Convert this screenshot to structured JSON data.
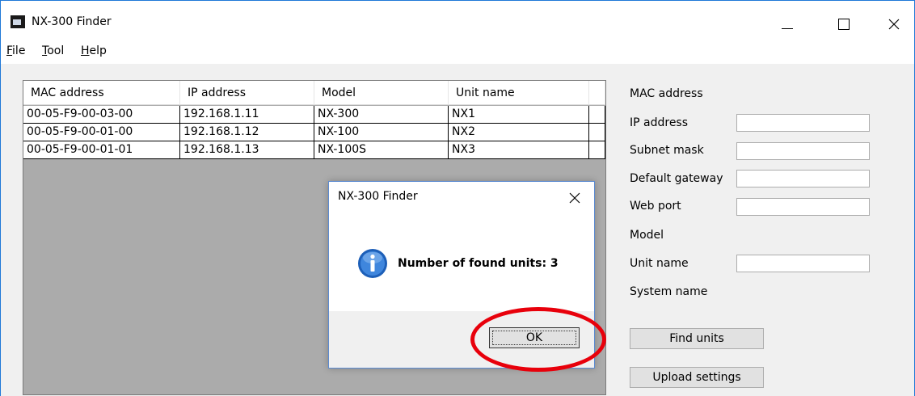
{
  "window": {
    "title": "NX-300 Finder",
    "icon": "app-speaker-icon"
  },
  "menu": {
    "items": [
      "File",
      "Tool",
      "Help"
    ]
  },
  "table": {
    "columns": [
      "MAC address",
      "IP address",
      "Model",
      "Unit name"
    ],
    "rows": [
      [
        "00-05-F9-00-03-00",
        "192.168.1.11",
        "NX-300",
        "NX1"
      ],
      [
        "00-05-F9-00-01-00",
        "192.168.1.12",
        "NX-100",
        "NX2"
      ],
      [
        "00-05-F9-00-01-01",
        "192.168.1.13",
        "NX-100S",
        "NX3"
      ]
    ]
  },
  "settings": {
    "mac_label": "MAC address",
    "ip_label": "IP address",
    "subnet_label": "Subnet mask",
    "gateway_label": "Default gateway",
    "webport_label": "Web port",
    "model_label": "Model",
    "unitname_label": "Unit name",
    "systemname_label": "System name",
    "ip_value": "",
    "subnet_value": "",
    "gateway_value": "",
    "webport_value": "",
    "unitname_value": ""
  },
  "buttons": {
    "find_units": "Find units",
    "upload_settings": "Upload settings"
  },
  "dialog": {
    "title": "NX-300 Finder",
    "message": "Number of found units: 3",
    "ok_label": "OK",
    "icon": "info-icon"
  },
  "colors": {
    "highlight": "#e8000b",
    "window_border": "#1e78d7",
    "info_blue": "#1d5fb8"
  }
}
